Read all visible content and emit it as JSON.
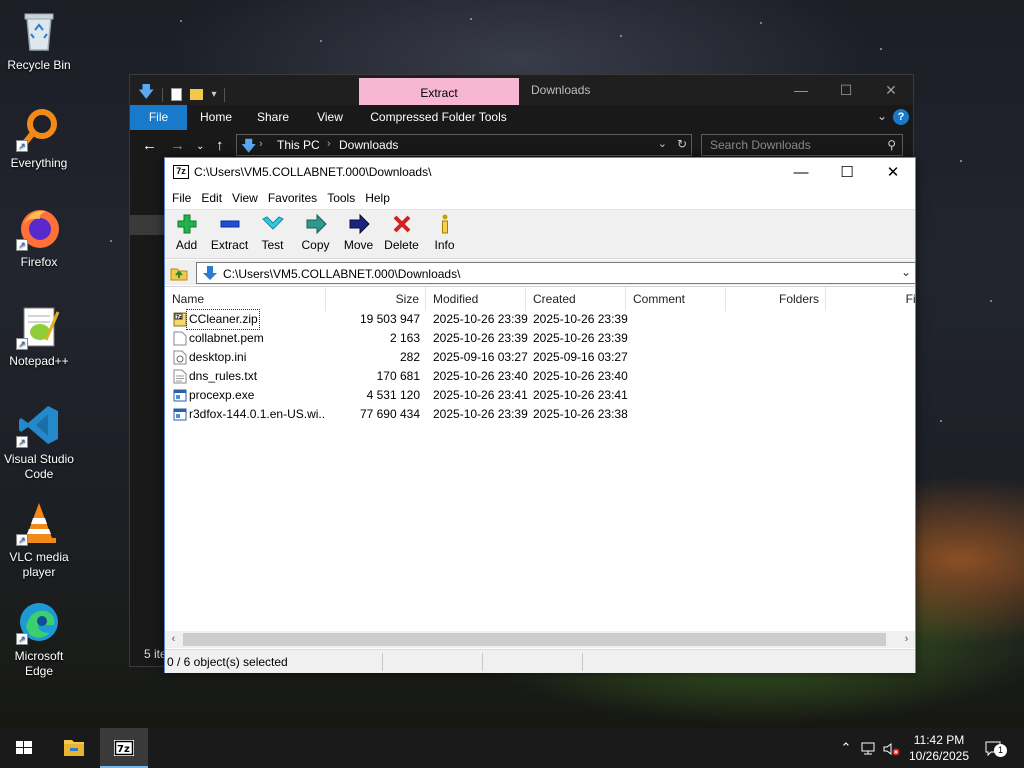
{
  "desktop": {
    "icons": [
      {
        "label": "Recycle Bin",
        "icon": "recycle-bin-icon"
      },
      {
        "label": "Everything",
        "icon": "everything-search-icon"
      },
      {
        "label": "Firefox",
        "icon": "firefox-icon"
      },
      {
        "label": "Notepad++",
        "icon": "notepad-plus-plus-icon"
      },
      {
        "label": "Visual Studio Code",
        "icon": "vscode-icon"
      },
      {
        "label": "VLC media player",
        "icon": "vlc-icon"
      },
      {
        "label": "Microsoft Edge",
        "icon": "edge-icon"
      }
    ]
  },
  "explorer": {
    "title": "Downloads",
    "contextual_tab": "Extract",
    "ribbon_tabs": [
      "File",
      "Home",
      "Share",
      "View",
      "Compressed Folder Tools"
    ],
    "breadcrumb": [
      "This PC",
      "Downloads"
    ],
    "search_placeholder": "Search Downloads",
    "status_partial": "5 ite"
  },
  "sevenzip": {
    "title": "C:\\Users\\VM5.COLLABNET.000\\Downloads\\",
    "menu": [
      "File",
      "Edit",
      "View",
      "Favorites",
      "Tools",
      "Help"
    ],
    "toolbar": [
      {
        "label": "Add",
        "icon": "add-icon",
        "color": "#22b14c"
      },
      {
        "label": "Extract",
        "icon": "extract-icon",
        "color": "#1f4fd8"
      },
      {
        "label": "Test",
        "icon": "test-icon",
        "color": "#33c8e0"
      },
      {
        "label": "Copy",
        "icon": "copy-icon",
        "color": "#2e9a8a"
      },
      {
        "label": "Move",
        "icon": "move-icon",
        "color": "#1a237e"
      },
      {
        "label": "Delete",
        "icon": "delete-icon",
        "color": "#d32020"
      },
      {
        "label": "Info",
        "icon": "info-icon",
        "color": "#c8a000"
      }
    ],
    "path": "C:\\Users\\VM5.COLLABNET.000\\Downloads\\",
    "columns": [
      "Name",
      "Size",
      "Modified",
      "Created",
      "Comment",
      "Folders",
      "File"
    ],
    "files": [
      {
        "name": "CCleaner.zip",
        "size": "19 503 947",
        "modified": "2025-10-26 23:39",
        "created": "2025-10-26 23:39",
        "type": "zip"
      },
      {
        "name": "collabnet.pem",
        "size": "2 163",
        "modified": "2025-10-26 23:39",
        "created": "2025-10-26 23:39",
        "type": "file"
      },
      {
        "name": "desktop.ini",
        "size": "282",
        "modified": "2025-09-16 03:27",
        "created": "2025-09-16 03:27",
        "type": "ini"
      },
      {
        "name": "dns_rules.txt",
        "size": "170 681",
        "modified": "2025-10-26 23:40",
        "created": "2025-10-26 23:40",
        "type": "txt"
      },
      {
        "name": "procexp.exe",
        "size": "4 531 120",
        "modified": "2025-10-26 23:41",
        "created": "2025-10-26 23:41",
        "type": "exe"
      },
      {
        "name": "r3dfox-144.0.1.en-US.wi...",
        "size": "77 690 434",
        "modified": "2025-10-26 23:39",
        "created": "2025-10-26 23:38",
        "type": "exe"
      }
    ],
    "status": "0 / 6 object(s) selected"
  },
  "taskbar": {
    "time": "11:42 PM",
    "date": "10/26/2025",
    "notification_count": "1"
  }
}
